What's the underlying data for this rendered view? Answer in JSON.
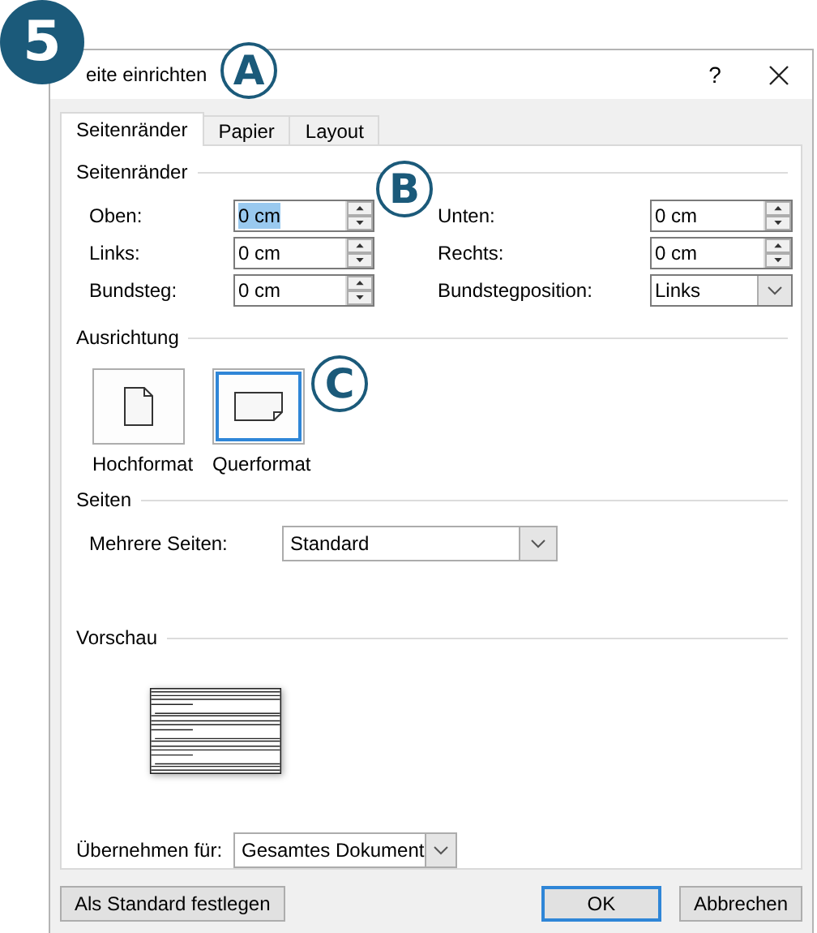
{
  "badges": [
    {
      "label": "5",
      "kind": "step"
    },
    {
      "label": "A",
      "kind": "callout"
    },
    {
      "label": "B",
      "kind": "callout"
    },
    {
      "label": "C",
      "kind": "callout"
    }
  ],
  "window": {
    "title": "eite einrichten",
    "help": "?"
  },
  "tabs": [
    {
      "label": "Seitenränder",
      "selected": true
    },
    {
      "label": "Papier",
      "selected": false
    },
    {
      "label": "Layout",
      "selected": false
    }
  ],
  "margins": {
    "title": "Seitenränder",
    "fields": [
      {
        "label": "Oben:",
        "value": "0 cm",
        "kind": "spin",
        "selected": true
      },
      {
        "label": "Unten:",
        "value": "0 cm",
        "kind": "spin",
        "selected": false
      },
      {
        "label": "Links:",
        "value": "0 cm",
        "kind": "spin",
        "selected": false
      },
      {
        "label": "Rechts:",
        "value": "0 cm",
        "kind": "spin",
        "selected": false
      },
      {
        "label": "Bundsteg:",
        "value": "0 cm",
        "kind": "spin",
        "selected": false
      },
      {
        "label": "Bundstegposition:",
        "value": "Links",
        "kind": "dropdown",
        "selected": false
      }
    ]
  },
  "orientation": {
    "title": "Ausrichtung",
    "options": [
      {
        "label": "Hochformat",
        "kind": "portrait",
        "selected": false
      },
      {
        "label": "Querformat",
        "kind": "landscape",
        "selected": true
      }
    ]
  },
  "pages": {
    "title": "Seiten",
    "label": "Mehrere Seiten:",
    "value": "Standard"
  },
  "preview": {
    "title": "Vorschau"
  },
  "apply_to": {
    "label": "Übernehmen für:",
    "value": "Gesamtes Dokument"
  },
  "buttons": [
    {
      "label": "Als Standard festlegen",
      "kind": "normal"
    },
    {
      "label": "OK",
      "kind": "default"
    },
    {
      "label": "Abbrechen",
      "kind": "normal"
    }
  ]
}
